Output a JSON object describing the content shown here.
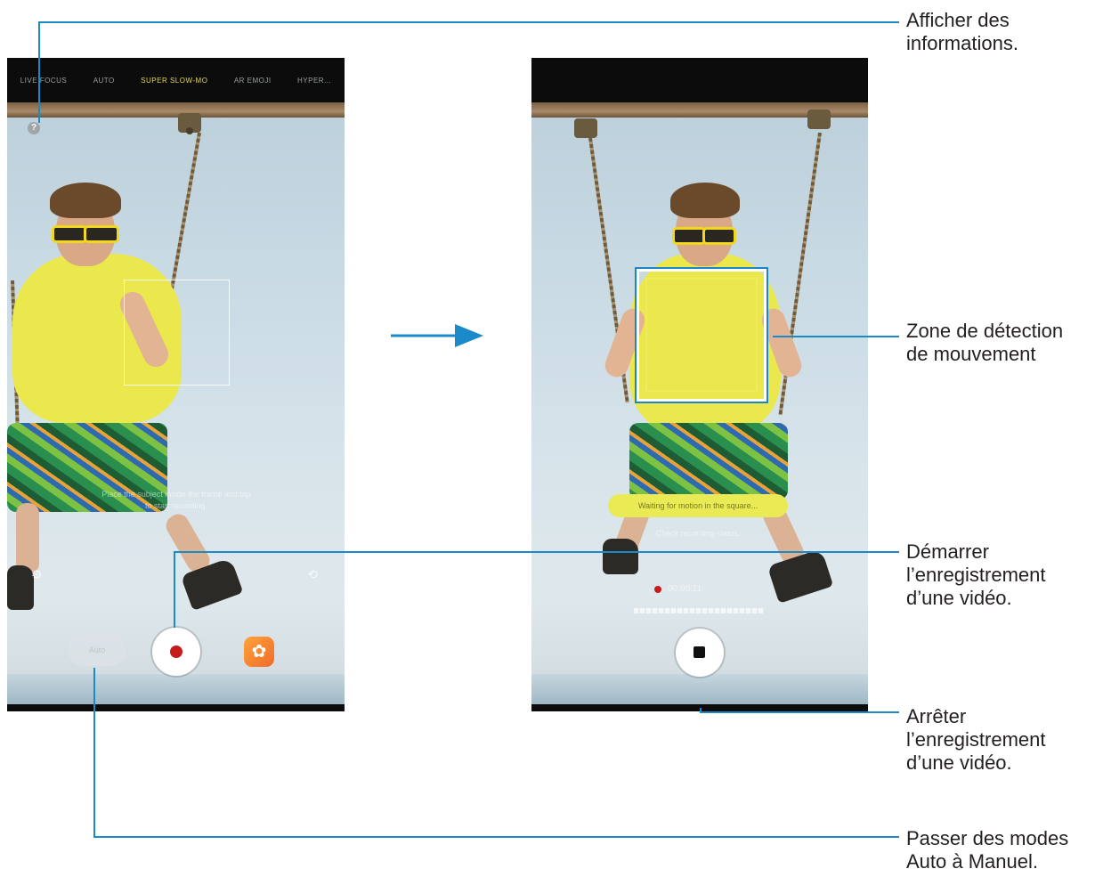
{
  "left_screen": {
    "mode_tabs": [
      "LIVE FOCUS",
      "AUTO",
      "SUPER SLOW-MO",
      "AR EMOJI",
      "HYPER..."
    ],
    "active_mode_index": 2,
    "info_icon_glyph": "?",
    "hint_lines": [
      "Place the subject inside the frame and tap",
      "to start recording."
    ],
    "mode_toggle_label": "Auto"
  },
  "right_screen": {
    "waiting_message": "Waiting for motion in the square...",
    "status_line": "Check recording status.",
    "rec_time": "00:00:11"
  },
  "callouts": {
    "info": [
      "Afficher des",
      "informations."
    ],
    "detection_zone": [
      "Zone de détection",
      "de mouvement"
    ],
    "start_recording": [
      "Démarrer",
      "l’enregistrement",
      "d’une vidéo."
    ],
    "stop_recording": [
      "Arrêter",
      "l’enregistrement",
      "d’une vidéo."
    ],
    "switch_mode": [
      "Passer des modes",
      "Auto à Manuel."
    ]
  },
  "colors": {
    "callout_line": "#1a8ac8",
    "record_red": "#c61b1b",
    "active_mode": "#e6d94a",
    "detect_frame_yellow": "#f1ea5a"
  },
  "icons": {
    "info": "question-circle-icon",
    "settings": "gear-icon",
    "switch_camera": "camera-switch-icon",
    "effects": "flower-effects-icon",
    "arrow": "right-arrow-icon"
  }
}
